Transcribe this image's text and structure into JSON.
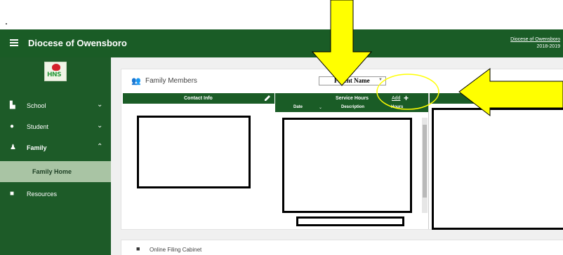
{
  "header": {
    "app_title": "Diocese of Owensboro",
    "diocese_link": "Diocese of Owensboro",
    "school_year": "2018-2019"
  },
  "logo": {
    "text": "HNS"
  },
  "sidebar": {
    "items": [
      {
        "label": "School",
        "icon": "school-icon",
        "chevron": "⌄"
      },
      {
        "label": "Student",
        "icon": "student-icon",
        "chevron": "⌄"
      },
      {
        "label": "Family",
        "icon": "family-icon",
        "chevron": "⌃"
      },
      {
        "label": "Family Home",
        "icon": ""
      },
      {
        "label": "Resources",
        "icon": "folder-icon"
      }
    ]
  },
  "family_card": {
    "title": "Family Members",
    "parent_select_value": "Parent Name",
    "contact_info": {
      "header": "Contact Info"
    },
    "service_hours": {
      "header": "Service Hours",
      "add_label": "Add",
      "columns": [
        "Date",
        "Description",
        "Hours"
      ]
    }
  },
  "filing_card": {
    "title": "Online Filing Cabinet"
  },
  "colors": {
    "brand_green": "#1a5c26",
    "nav_selected": "#a9c4a4",
    "arrow_yellow": "#ffff00"
  }
}
